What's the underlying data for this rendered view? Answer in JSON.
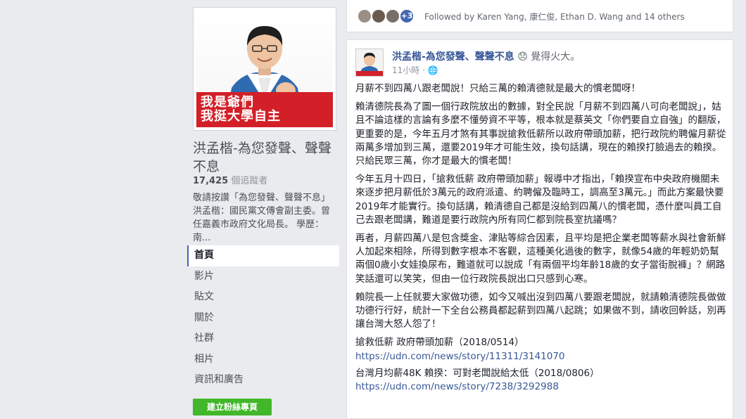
{
  "page": {
    "cover_line1": "我是爺們",
    "cover_line2": "我挺大學自主",
    "name": "洪孟楷-為您發聲、聲聲不息",
    "followers_count": "17,425",
    "followers_label": "個追蹤者",
    "description": "敬請按讚「為您發聲、聲聲不息」 洪孟楷：國民黨文傳會副主委。曾任嘉義市政府文化局長。 學歷：南..."
  },
  "nav": {
    "items": [
      {
        "label": "首頁"
      },
      {
        "label": "影片"
      },
      {
        "label": "貼文"
      },
      {
        "label": "關於"
      },
      {
        "label": "社群"
      },
      {
        "label": "相片"
      },
      {
        "label": "資訊和廣告"
      }
    ],
    "create_button": "建立粉絲專頁"
  },
  "follow_bar": {
    "more_count": "+3",
    "text": "Followed by Karen Yang, 康仁俊, Ethan D. Wang and 14 others"
  },
  "post": {
    "author": "洪孟楷-為您發聲、聲聲不息",
    "feeling": "😞 覺得火大。",
    "time": "11小時 · 🌐",
    "paragraphs": [
      "月薪不到四萬八跟老闆說！只給三萬的賴清德就是最大的慣老闆呀！",
      "賴清德院長為了圖一個行政院放出的數據，對全民說「月薪不到四萬八可向老闆說」，姑且不論這樣的言論有多麼不懂勞資不平等，根本就是蔡英文「你們要自立自強」的翻版，更重要的是，今年五月才煞有其事說搶救低薪所以政府帶頭加薪，把行政院約聘僱月薪從兩萬多增加到三萬，還要2019年才可能生效，換句話講，現在的賴揆打臉過去的賴揆。只給民眾三萬，你才是最大的慣老闆！",
      "今年五月十四日，「搶救低薪 政府帶頭加薪」報導中才指出，「賴揆宣布中央政府機關未來逐步把月薪低於3萬元的政府派遣、約聘僱及臨時工，調高至3萬元。」而此方案最快要2019年才能實行。換句話講，賴清德自己都是沒給到四萬八的慣老闆，憑什麼叫員工自己去跟老闆講，難道是要行政院內所有同仁都到院長室抗議嗎？",
      "再者，月薪四萬八是包含獎金、津貼等綜合因素，且平均是把企業老闆等薪水與社會新鮮人加起來相除，所得到數字根本不客觀，這種美化過後的數字，就像54歲的年輕奶奶幫兩個0歲小女娃換尿布，難道就可以說成「有兩個平均年齡18歲的女子當街脫褲」？網路笑話還可以笑笑，但由一位行政院長說出口只感到心寒。",
      "賴院長一上任就要大家做功德，如今又喊出沒到四萬八要跟老闆說，就請賴清德院長做做功德行行好，統計一下全台公務員都起薪到四萬八起跳；如果做不到，請收回幹話，別再讓台灣大怒人怨了！"
    ],
    "ref1_title": "搶救低薪 政府帶頭加薪（2018/0514）",
    "ref1_url": "https://udn.com/news/story/11311/3141070",
    "ref2_title": "台灣月均薪48K 賴揆：可對老闆說給太低（2018/0806）",
    "ref2_url": "https://udn.com/news/story/7238/3292988"
  },
  "colors": {
    "background": "#e9ebee",
    "link": "#385898",
    "banner_red": "#d32028",
    "create_green": "#42b72a"
  }
}
